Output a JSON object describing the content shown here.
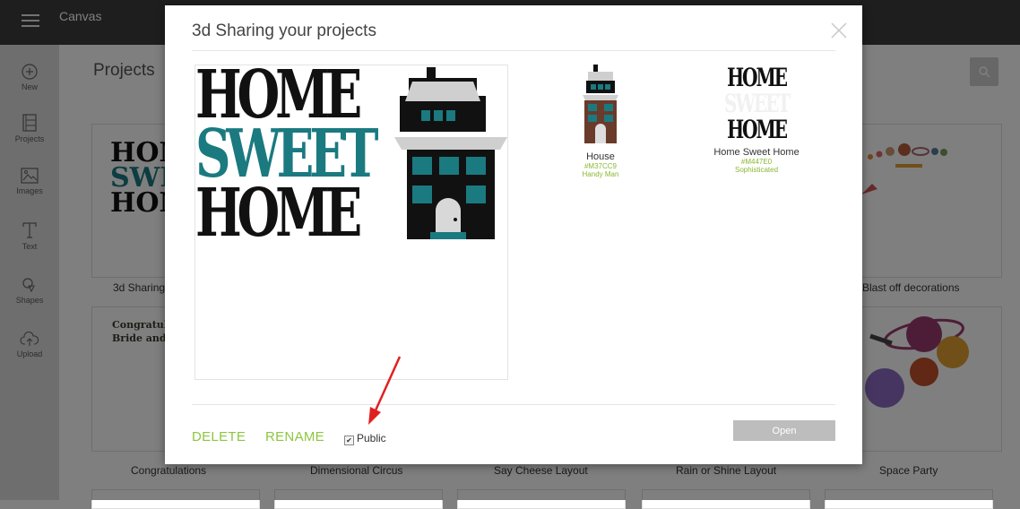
{
  "app": {
    "title": "Canvas"
  },
  "sidebar": {
    "items": [
      {
        "label": "New",
        "icon": "plus-circle-icon"
      },
      {
        "label": "Projects",
        "icon": "projects-icon"
      },
      {
        "label": "Images",
        "icon": "image-icon"
      },
      {
        "label": "Text",
        "icon": "text-icon"
      },
      {
        "label": "Shapes",
        "icon": "shapes-icon"
      },
      {
        "label": "Upload",
        "icon": "upload-icon"
      }
    ]
  },
  "main": {
    "heading": "Projects",
    "search_icon": "search-icon",
    "cards_row1": [
      "3d Sharing",
      "Blast off decorations"
    ],
    "cards_row2": [
      "Congratulations",
      "Dimensional Circus",
      "Say Cheese Layout",
      "Rain or Shine Layout",
      "Space Party"
    ],
    "card_preview_texts": {
      "congrats": "Congratul",
      "bride": "Bride and",
      "home1": "HOM",
      "sweet": "SWEE",
      "home2": "HOM"
    }
  },
  "modal": {
    "title": "3d Sharing your projects",
    "preview_text": {
      "home_top": "HOME",
      "sweet": "SWEET",
      "home_bottom": "HOME"
    },
    "images": [
      {
        "name": "House",
        "id": "#M37CC9",
        "set": "Handy Man"
      },
      {
        "name": "Home Sweet Home",
        "id": "#M447E0",
        "set": "Sophisticated",
        "mini": {
          "home_top": "HOME",
          "sweet": "SWEET",
          "home_bottom": "HOME"
        }
      }
    ],
    "actions": {
      "delete": "DELETE",
      "rename": "RENAME",
      "public_label": "Public",
      "public_checked": true,
      "open": "Open"
    }
  },
  "colors": {
    "accent_green": "#8cc63f",
    "teal": "#1a7a80",
    "annotation_red": "#e02020"
  }
}
